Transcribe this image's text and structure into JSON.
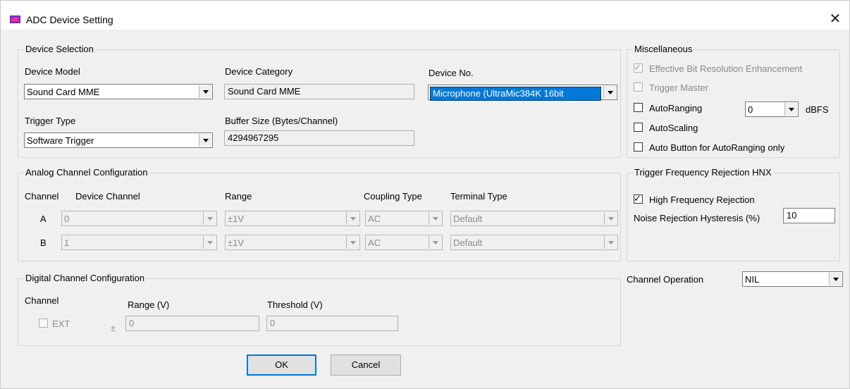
{
  "window": {
    "title": "ADC Device Setting",
    "close_glyph": "✕"
  },
  "device_selection": {
    "title": "Device Selection",
    "device_model_label": "Device Model",
    "device_model_value": "Sound Card MME",
    "device_category_label": "Device Category",
    "device_category_value": "Sound Card MME",
    "device_no_label": "Device No.",
    "device_no_value": "Microphone (UltraMic384K 16bit",
    "trigger_type_label": "Trigger Type",
    "trigger_type_value": "Software Trigger",
    "buffer_size_label": "Buffer Size (Bytes/Channel)",
    "buffer_size_value": "4294967295"
  },
  "miscellaneous": {
    "title": "Miscellaneous",
    "ebre_label": "Effective Bit Resolution Enhancement",
    "ebre_checked": true,
    "trigger_master_label": "Trigger Master",
    "trigger_master_checked": false,
    "autoranging_label": "AutoRanging",
    "autoranging_checked": false,
    "autoranging_value": "0",
    "autoranging_unit": "dBFS",
    "autoscaling_label": "AutoScaling",
    "autoscaling_checked": false,
    "auto_button_label": "Auto Button for AutoRanging only",
    "auto_button_checked": false
  },
  "analog": {
    "title": "Analog Channel Configuration",
    "col_channel": "Channel",
    "col_device_channel": "Device Channel",
    "col_range": "Range",
    "col_coupling": "Coupling Type",
    "col_terminal": "Terminal Type",
    "rows": [
      {
        "channel": "A",
        "device_channel": "0",
        "range": "±1V",
        "coupling": "AC",
        "terminal": "Default"
      },
      {
        "channel": "B",
        "device_channel": "1",
        "range": "±1V",
        "coupling": "AC",
        "terminal": "Default"
      }
    ]
  },
  "trigger_rejection": {
    "title": "Trigger Frequency Rejection HNX",
    "hfr_label": "High Frequency Rejection",
    "hfr_checked": true,
    "hysteresis_label": "Noise Rejection Hysteresis (%)",
    "hysteresis_value": "10"
  },
  "digital": {
    "title": "Digital Channel Configuration",
    "col_channel": "Channel",
    "col_range": "Range (V)",
    "col_threshold": "Threshold (V)",
    "ext_label": "EXT",
    "ext_checked": false,
    "pm_sign": "±",
    "range_value": "0",
    "threshold_value": "0"
  },
  "channel_operation": {
    "label": "Channel Operation",
    "value": "NIL"
  },
  "buttons": {
    "ok": "OK",
    "cancel": "Cancel"
  },
  "colors": {
    "selection": "#0078d7",
    "app_icon": "#9b2bd8",
    "focus_border": "#0078d7"
  }
}
